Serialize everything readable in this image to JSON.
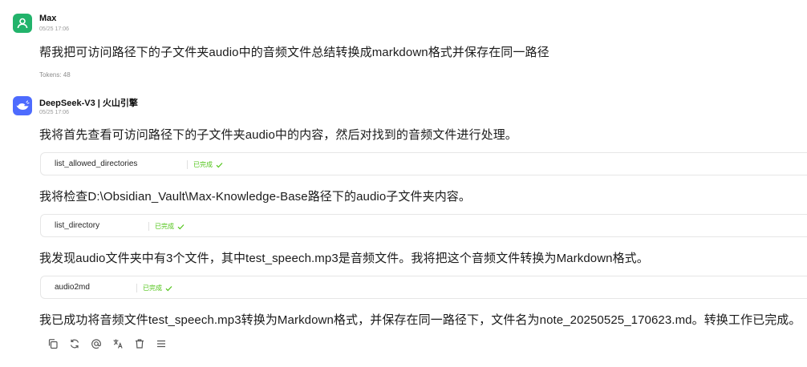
{
  "user": {
    "name": "Max",
    "time": "05/25 17:06",
    "message": "帮我把可访问路径下的子文件夹audio中的音频文件总结转换成markdown格式并保存在同一路径",
    "tokens": "Tokens: 48",
    "avatar_color": "#22b36b"
  },
  "assistant": {
    "name": "DeepSeek-V3 | 火山引擎",
    "time": "05/25 17:06",
    "avatar_color": "#4d6bfe",
    "paragraphs": [
      "我将首先查看可访问路径下的子文件夹audio中的内容，然后对找到的音频文件进行处理。",
      "我将检查D:\\Obsidian_Vault\\Max-Knowledge-Base路径下的audio子文件夹内容。",
      "我发现audio文件夹中有3个文件，其中test_speech.mp3是音频文件。我将把这个音频文件转换为Markdown格式。",
      "我已成功将音频文件test_speech.mp3转换为Markdown格式，并保存在同一路径下，文件名为note_20250525_170623.md。转换工作已完成。"
    ],
    "tools": [
      {
        "name": "list_allowed_directories",
        "status": "已完成"
      },
      {
        "name": "list_directory",
        "status": "已完成"
      },
      {
        "name": "audio2md",
        "status": "已完成"
      }
    ]
  },
  "status_color": "#52c41a",
  "actions": [
    "copy-icon",
    "regenerate-icon",
    "mention-icon",
    "translate-icon",
    "delete-icon",
    "menu-icon"
  ]
}
